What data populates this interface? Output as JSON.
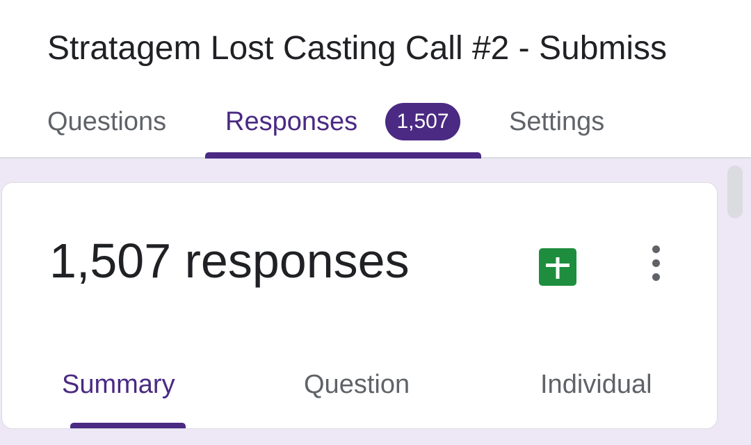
{
  "form": {
    "title": "Stratagem Lost Casting Call #2 - Submiss"
  },
  "tabs": {
    "questions": "Questions",
    "responses": "Responses",
    "responses_badge": "1,507",
    "settings": "Settings",
    "active": "Responses"
  },
  "summary_card": {
    "response_count": "1,507 responses",
    "sheets_icon": "google-sheets-icon",
    "more_icon": "more-vert-icon",
    "subtabs": {
      "summary": "Summary",
      "question": "Question",
      "individual": "Individual",
      "active": "Summary"
    }
  },
  "colors": {
    "accent": "#4a2a83",
    "page_background": "#ede7f6",
    "sheets_green": "#1e8e3e"
  }
}
